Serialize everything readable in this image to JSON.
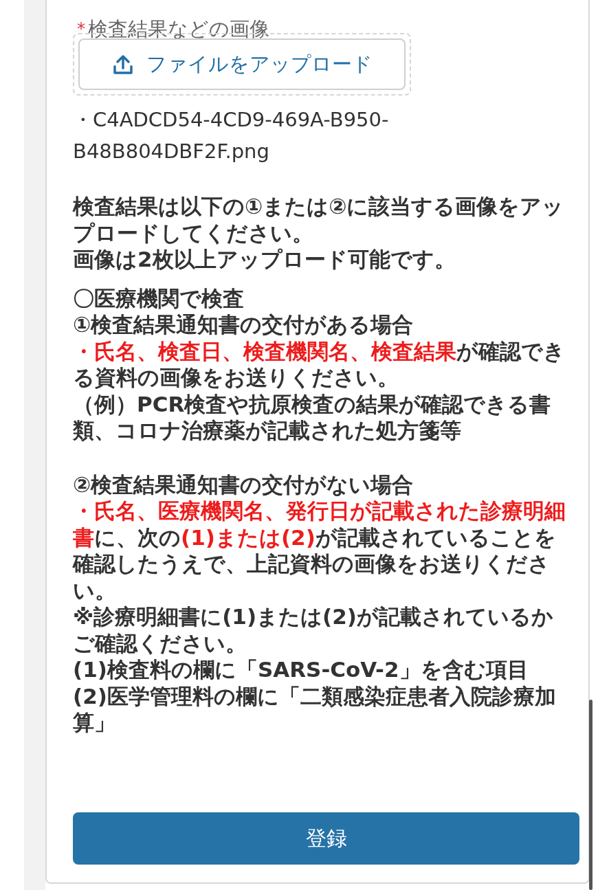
{
  "field": {
    "label": "検査結果などの画像",
    "required_mark": "*",
    "upload_button": "ファイルをアップロード",
    "files": [
      "・C4ADCD54-4CD9-469A-B950-B48B804DBF2F.png"
    ]
  },
  "notes": [
    {
      "lines": [
        [
          {
            "text": "検査結果は以下の①または②に該当する画像をアップロードしてください。",
            "emphasis": false
          }
        ],
        [
          {
            "text": "画像は2枚以上アップロード可能です。",
            "emphasis": false
          }
        ]
      ]
    },
    {
      "lines": [
        [
          {
            "text": "〇医療機関で検査",
            "emphasis": false
          }
        ],
        [
          {
            "text": "①検査結果通知書の交付がある場合",
            "emphasis": false
          }
        ],
        [
          {
            "text": "・氏名、検査日、検査機関名、検査結果",
            "emphasis": true
          },
          {
            "text": "が確認できる資料の画像をお送りください。",
            "emphasis": false
          }
        ],
        [
          {
            "text": "（例）PCR検査や抗原検査の結果が確認できる書類、コロナ治療薬が記載された処方箋等",
            "emphasis": false
          }
        ]
      ]
    },
    {
      "lines": [
        [
          {
            "text": "②検査結果通知書の交付がない場合",
            "emphasis": false
          }
        ],
        [
          {
            "text": "・氏名、医療機関名、発行日が記載された診療明細書",
            "emphasis": true
          },
          {
            "text": "に、次の",
            "emphasis": false
          },
          {
            "text": "(1)または(2)",
            "emphasis": true
          },
          {
            "text": "が記載されていることを確認したうえで、上記資料の画像をお送りください。",
            "emphasis": false
          }
        ],
        [
          {
            "text": "※診療明細書に(1)または(2)が記載されているかご確認ください。",
            "emphasis": false
          }
        ],
        [
          {
            "text": "(1)検査料の欄に「SARS-CoV-2」を含む項目",
            "emphasis": false
          }
        ],
        [
          {
            "text": "(2)医学管理料の欄に「二類感染症患者入院診療加算」",
            "emphasis": false
          }
        ]
      ]
    }
  ],
  "submit_button": "登録"
}
